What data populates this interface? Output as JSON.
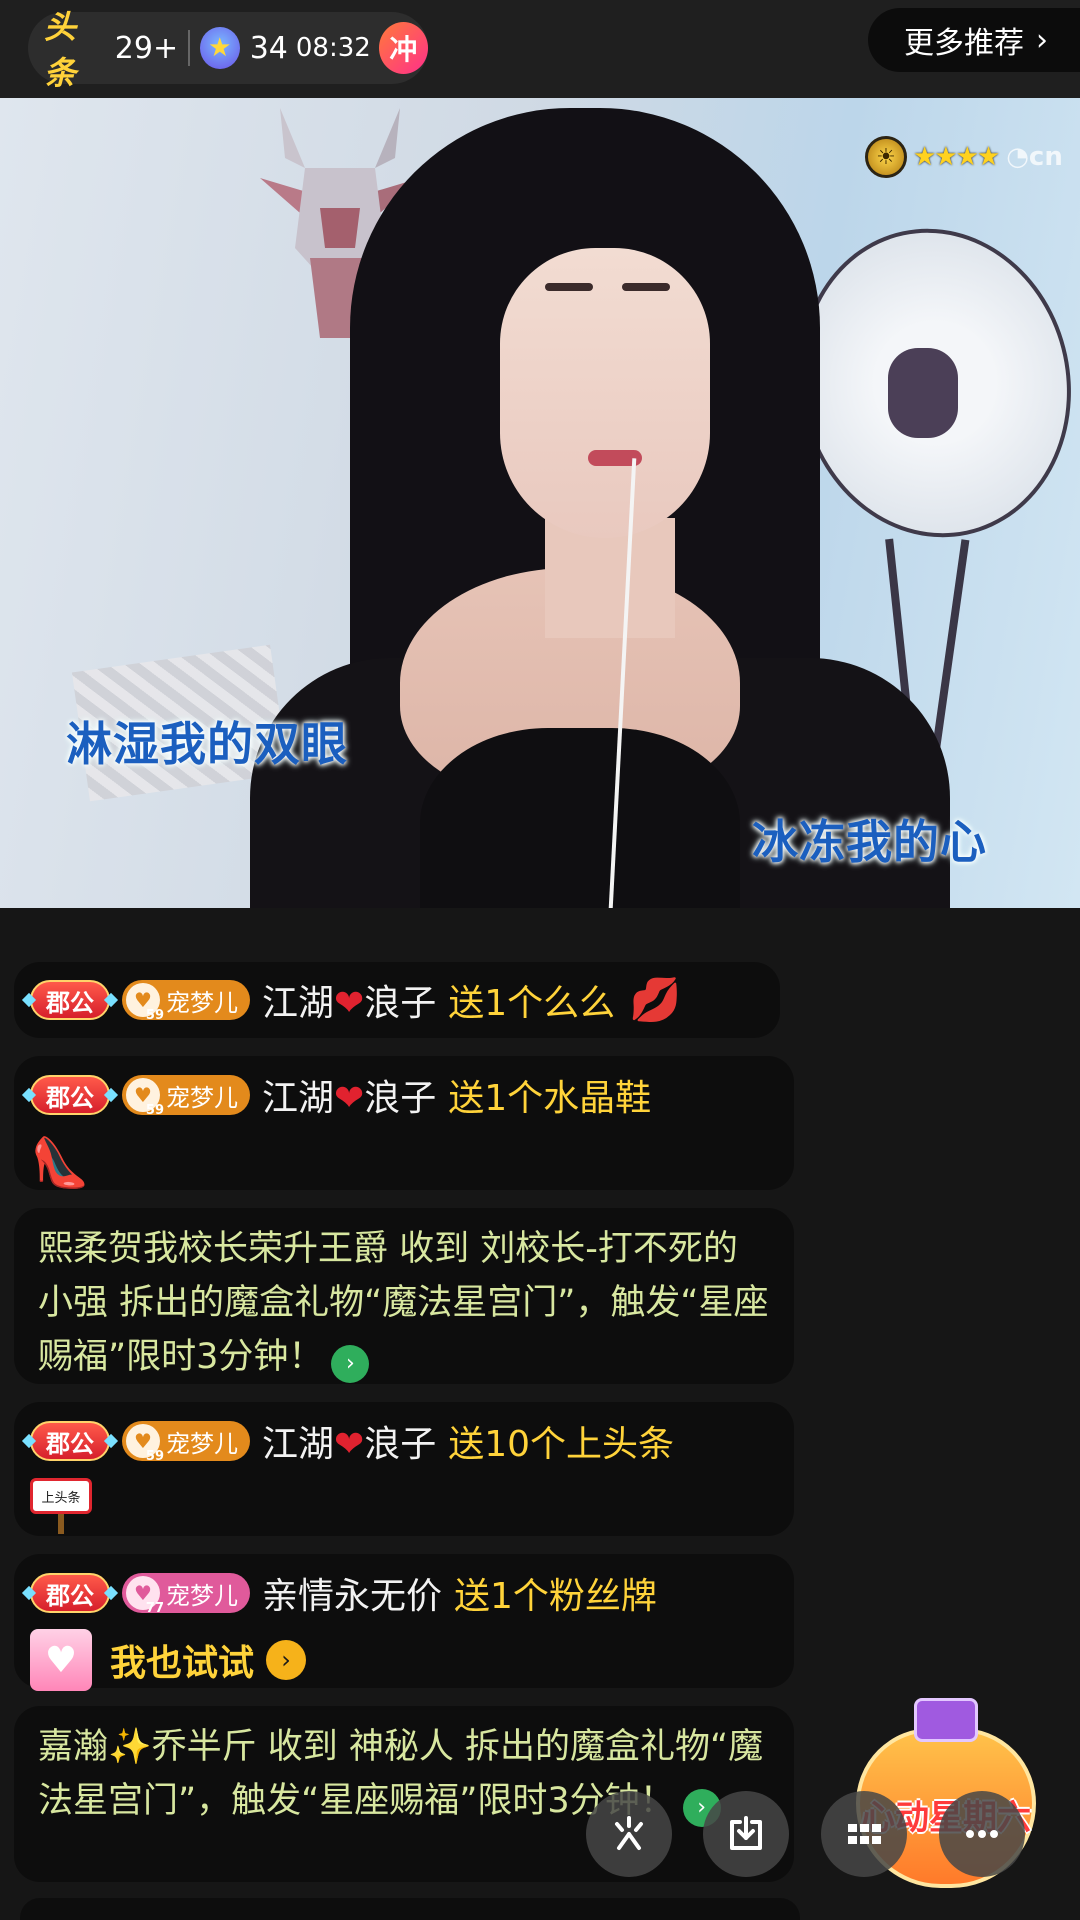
{
  "topbar": {
    "headline_logo": "头条",
    "headline_count": "29+",
    "star_icon": "star-icon",
    "star_count": "34",
    "timer": "08:32",
    "rush_label": "冲",
    "more_label": "更多推荐",
    "more_icon": "chevron-right-icon"
  },
  "video": {
    "lyric_left": "淋湿我的双眼",
    "lyric_right": "冰冻我的心",
    "watermark_stars": "★★★★"
  },
  "chat": {
    "messages": [
      {
        "rank": "郡公",
        "fan_name": "宠梦儿",
        "fan_level": "59",
        "user_a": "江湖",
        "heart": "❤",
        "user_b": "浪子",
        "gift": "送1个么么",
        "gift_icon": "kiss-lips-icon"
      },
      {
        "rank": "郡公",
        "fan_name": "宠梦儿",
        "fan_level": "59",
        "user_a": "江湖",
        "heart": "❤",
        "user_b": "浪子",
        "gift": "送1个水晶鞋",
        "gift_icon": "crystal-shoe-icon"
      },
      {
        "system_text": "熙柔贺我校长荣升王爵 收到 刘校长-打不死的小强 拆出的魔盒礼物“魔法星宫门”，触发“星座赐福”限时3分钟！"
      },
      {
        "rank": "郡公",
        "fan_name": "宠梦儿",
        "fan_level": "59",
        "user_a": "江湖",
        "heart": "❤",
        "user_b": "浪子",
        "gift": "送10个上头条",
        "sign_text": "上头条"
      },
      {
        "rank": "郡公",
        "fan_name": "宠梦儿",
        "fan_level": "77",
        "user": "亲情永无价",
        "gift": "送1个粉丝牌",
        "try_label": "我也试试"
      },
      {
        "system_text": "嘉瀚✨乔半斤 收到 神秘人 拆出的魔盒礼物“魔法星宫门”，触发“星座赐福”限时3分钟！"
      }
    ]
  },
  "promo": {
    "label": "心动星期六"
  },
  "toolbar": {
    "buttons": [
      "share-icon",
      "download-icon",
      "grid-menu-icon",
      "more-dots-icon"
    ]
  }
}
